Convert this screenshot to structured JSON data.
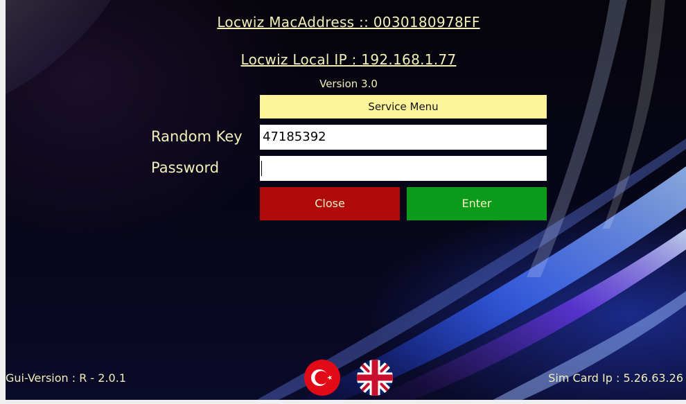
{
  "header": {
    "mac_address": "Locwiz MacAddress :: 0030180978FF",
    "local_ip": "Locwiz Local IP : 192.168.1.77",
    "version": "Version 3.0"
  },
  "form": {
    "title": "Service Menu",
    "random_key_label": "Random Key",
    "random_key_value": "47185392",
    "password_label": "Password",
    "password_value": "",
    "close_label": "Close",
    "enter_label": "Enter"
  },
  "footer": {
    "gui_version": "Gui-Version : R - 2.0.1",
    "sim_card_ip": "Sim Card Ip : 5.26.63.26",
    "languages": [
      {
        "icon": "turkey-flag-icon"
      },
      {
        "icon": "uk-flag-icon"
      }
    ]
  },
  "colors": {
    "text": "#f3efb8",
    "title_bar": "#fdf49a",
    "close": "#b00a0a",
    "enter": "#0b9a1a"
  }
}
